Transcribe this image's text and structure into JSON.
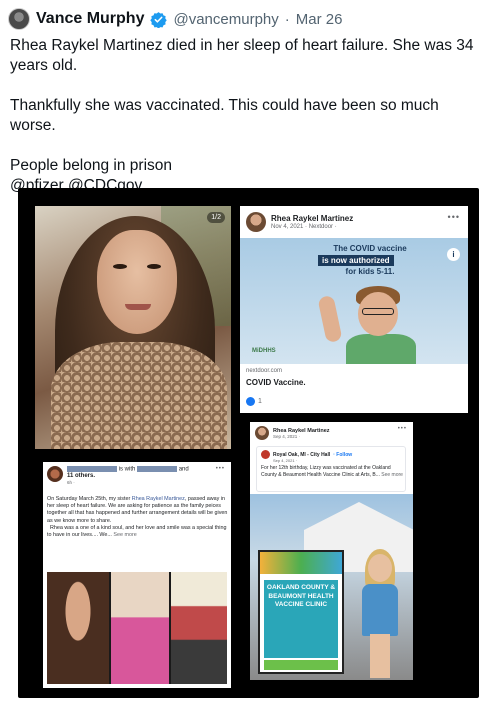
{
  "tweet": {
    "author_name": "Vance Murphy",
    "handle": "@vancemurphy",
    "separator": "·",
    "date": "Mar 26",
    "lines": [
      "Rhea Raykel Martinez died in her sleep of heart failure. She was 34 years old.",
      "Thankfully she was vaccinated. This could have been so much worse.",
      "People belong in prison",
      "@pfizer @CDCgov"
    ],
    "accent_color": "#1d9bf0"
  },
  "media": {
    "photo_counter": "1/2",
    "nextdoor_card": {
      "poster": "Rhea Raykel Martinez",
      "meta": "Nov 4, 2021 · Nextdoor · ",
      "headline_1": "The COVID vaccine",
      "headline_2": "is now authorized",
      "headline_3": "for kids 5-11.",
      "logo_text": "MiDHHS",
      "url": "nextdoor.com",
      "link_title": "COVID Vaccine.",
      "reaction_count": "1"
    },
    "city_hall_card": {
      "poster": "Rhea Raykel Martinez",
      "poster_date": "Sep 4, 2021 · ",
      "org": "Royal Oak, MI - City Hall",
      "follow": "· Follow",
      "org_date": "Sep 4, 2021 · ",
      "body": "For her 12th birthday, Lizzy was vaccinated at the Oakland County & Beaumont Health Vaccine Clinic at Arts, B...",
      "see_more": "See more",
      "sign_text": "OAKLAND COUNTY & BEAUMONT HEALTH VACCINE CLINIC"
    },
    "facebook_card": {
      "with_text": "is with",
      "and_text": "and",
      "others": "11 others.",
      "time": "6h · ",
      "body_1": "On Saturday March 25th, my sister ",
      "body_link": "Rhea Raykel Martinez",
      "body_2": ", passed away in her sleep of heart failure. We are asking for patience as the family peices together all that has happened and further arrangement details will be given as we know more to share.",
      "body_3": "Rhea was a one of a kind soul, and her love and smile was a special thing to have in our lives.... We...",
      "see_more": "See more"
    }
  }
}
